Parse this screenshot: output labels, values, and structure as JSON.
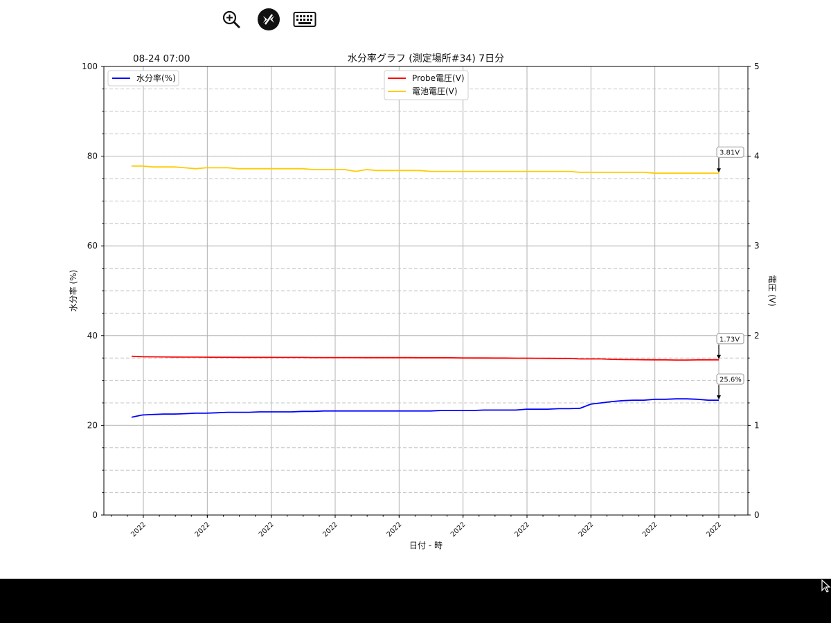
{
  "toolbar": {
    "zoom_icon": "zoom-in-icon",
    "remote_icon": "remote-desktop-icon",
    "keyboard_icon": "keyboard-icon"
  },
  "chart_data": {
    "type": "line",
    "title": "水分率グラフ (測定場所#34) 7日分",
    "corner_label": "08-24 07:00",
    "xlabel": "日付 - 時",
    "ylabel_left": "水分率 (%)",
    "ylabel_right": "電圧 (V)",
    "ylim_left": [
      0,
      100
    ],
    "ylim_right": [
      0,
      5
    ],
    "yticks_left": [
      "0",
      "20",
      "40",
      "60",
      "80",
      "100"
    ],
    "yticks_right": [
      "0",
      "1",
      "2",
      "3",
      "4",
      "5"
    ],
    "x_tick_labels": [
      "2022",
      "2022",
      "2022",
      "2022",
      "2022",
      "2022",
      "2022",
      "2022",
      "2022",
      "2022"
    ],
    "grid": true,
    "legend_left": "upper-left",
    "legend_right": "upper-center",
    "series": [
      {
        "name": "水分率(%)",
        "axis": "left",
        "color": "#0000ff",
        "values": [
          21.8,
          22.3,
          22.4,
          22.5,
          22.5,
          22.6,
          22.7,
          22.7,
          22.8,
          22.9,
          22.9,
          22.9,
          23.0,
          23.0,
          23.0,
          23.0,
          23.1,
          23.1,
          23.2,
          23.2,
          23.2,
          23.2,
          23.2,
          23.2,
          23.2,
          23.2,
          23.2,
          23.2,
          23.2,
          23.3,
          23.3,
          23.3,
          23.3,
          23.4,
          23.4,
          23.4,
          23.4,
          23.6,
          23.6,
          23.6,
          23.7,
          23.7,
          23.8,
          24.7,
          25.0,
          25.3,
          25.5,
          25.6,
          25.6,
          25.8,
          25.8,
          25.9,
          25.9,
          25.8,
          25.6,
          25.6
        ]
      },
      {
        "name": "Probe電圧(V)",
        "axis": "right",
        "color": "#ff0000",
        "values": [
          1.77,
          1.765,
          1.763,
          1.762,
          1.761,
          1.76,
          1.76,
          1.759,
          1.758,
          1.758,
          1.757,
          1.757,
          1.757,
          1.757,
          1.756,
          1.756,
          1.756,
          1.755,
          1.755,
          1.755,
          1.755,
          1.755,
          1.754,
          1.754,
          1.754,
          1.754,
          1.754,
          1.753,
          1.753,
          1.752,
          1.752,
          1.751,
          1.75,
          1.75,
          1.749,
          1.749,
          1.748,
          1.748,
          1.747,
          1.746,
          1.745,
          1.745,
          1.74,
          1.74,
          1.74,
          1.735,
          1.733,
          1.732,
          1.731,
          1.73,
          1.729,
          1.728,
          1.728,
          1.729,
          1.73,
          1.73
        ]
      },
      {
        "name": "電池電圧(V)",
        "axis": "right",
        "color": "#ffcc00",
        "values": [
          3.89,
          3.89,
          3.88,
          3.88,
          3.88,
          3.87,
          3.86,
          3.87,
          3.87,
          3.87,
          3.86,
          3.86,
          3.86,
          3.86,
          3.86,
          3.86,
          3.86,
          3.85,
          3.85,
          3.85,
          3.85,
          3.83,
          3.85,
          3.84,
          3.84,
          3.84,
          3.84,
          3.84,
          3.83,
          3.83,
          3.83,
          3.83,
          3.83,
          3.83,
          3.83,
          3.83,
          3.83,
          3.83,
          3.83,
          3.83,
          3.83,
          3.83,
          3.82,
          3.82,
          3.82,
          3.82,
          3.82,
          3.82,
          3.82,
          3.81,
          3.81,
          3.81,
          3.81,
          3.81,
          3.81,
          3.81
        ]
      }
    ],
    "annotations": [
      {
        "text": "3.81V",
        "series": 2
      },
      {
        "text": "1.73V",
        "series": 1
      },
      {
        "text": "25.6%",
        "series": 0
      }
    ]
  }
}
